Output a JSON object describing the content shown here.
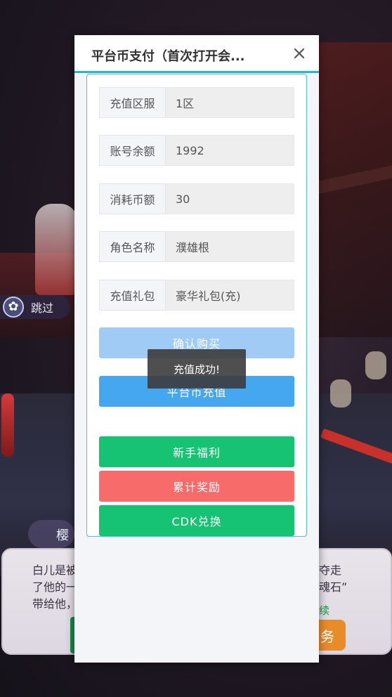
{
  "modal": {
    "title": "平台币支付（首次打开会...",
    "close_icon": "close-icon",
    "fields": [
      {
        "label": "充值区服",
        "value": "1区"
      },
      {
        "label": "账号余额",
        "value": "1992"
      },
      {
        "label": "消耗币额",
        "value": "30"
      },
      {
        "label": "角色名称",
        "value": "濮雄根"
      },
      {
        "label": "充值礼包",
        "value": "豪华礼包(充)"
      }
    ],
    "buttons": {
      "confirm": "确认购买",
      "recharge": "平台币充值",
      "newbie": "新手福利",
      "cumulative": "累计奖励",
      "cdk": "CDK兑换"
    },
    "toast": "充值成功!",
    "colors": {
      "accent": "#29b6d1",
      "confirm": "#9fcbf5",
      "recharge": "#45a7f0",
      "green": "#15c372",
      "red": "#f76b6b"
    }
  },
  "game": {
    "skip_label": "跳过",
    "skip_icon": "sakura-icon",
    "speaker": "樱",
    "dialog_left": [
      "白儿是被",
      "了他的一",
      "带给他，"
    ],
    "dialog_right": [
      "夺走",
      "魂石”"
    ],
    "continue": "续",
    "task": "务"
  }
}
